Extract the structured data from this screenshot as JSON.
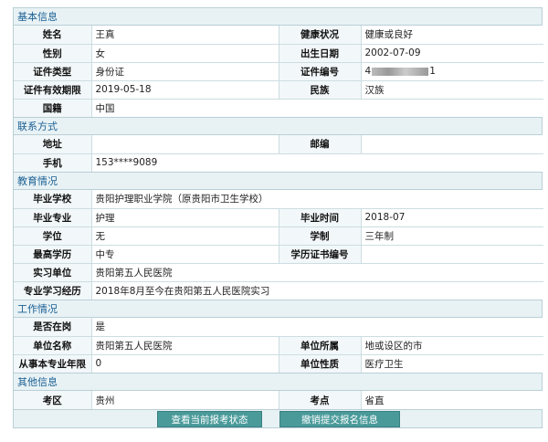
{
  "basic": {
    "title": "基本信息",
    "name_label": "姓名",
    "name": "王真",
    "health_label": "健康状况",
    "health": "健康或良好",
    "gender_label": "性别",
    "gender": "女",
    "birth_label": "出生日期",
    "birth": "2002-07-09",
    "idtype_label": "证件类型",
    "idtype": "身份证",
    "idno_label": "证件编号",
    "idno_prefix": "4",
    "idno_suffix": "1",
    "idexpiry_label": "证件有效期限",
    "idexpiry": "2019-05-18",
    "ethnicity_label": "民族",
    "ethnicity": "汉族",
    "nationality_label": "国籍",
    "nationality": "中国"
  },
  "contact": {
    "title": "联系方式",
    "address_label": "地址",
    "address": "",
    "postcode_label": "邮编",
    "postcode": "",
    "phone_label": "手机",
    "phone": "153****9089"
  },
  "education": {
    "title": "教育情况",
    "school_label": "毕业学校",
    "school": "贵阳护理职业学院（原贵阳市卫生学校）",
    "major_label": "毕业专业",
    "major": "护理",
    "gradtime_label": "毕业时间",
    "gradtime": "2018-07",
    "degree_label": "学位",
    "degree": "无",
    "duration_label": "学制",
    "duration": "三年制",
    "edu_label": "最高学历",
    "edu": "中专",
    "certno_label": "学历证书编号",
    "certno": "",
    "intern_label": "实习单位",
    "intern": "贵阳第五人民医院",
    "study_label": "专业学习经历",
    "study": "2018年8月至今在贵阳第五人民医院实习"
  },
  "work": {
    "title": "工作情况",
    "onduty_label": "是否在岗",
    "onduty": "是",
    "unit_label": "单位名称",
    "unit": "贵阳第五人民医院",
    "affil_label": "单位所属",
    "affil": "地或设区的市",
    "years_label": "从事本专业年限",
    "years": "0",
    "nature_label": "单位性质",
    "nature": "医疗卫生"
  },
  "other": {
    "title": "其他信息",
    "area_label": "考区",
    "area": "贵州",
    "site_label": "考点",
    "site": "省直"
  },
  "buttons": {
    "status": "查看当前报考状态",
    "cancel": "撤销提交报名信息"
  }
}
